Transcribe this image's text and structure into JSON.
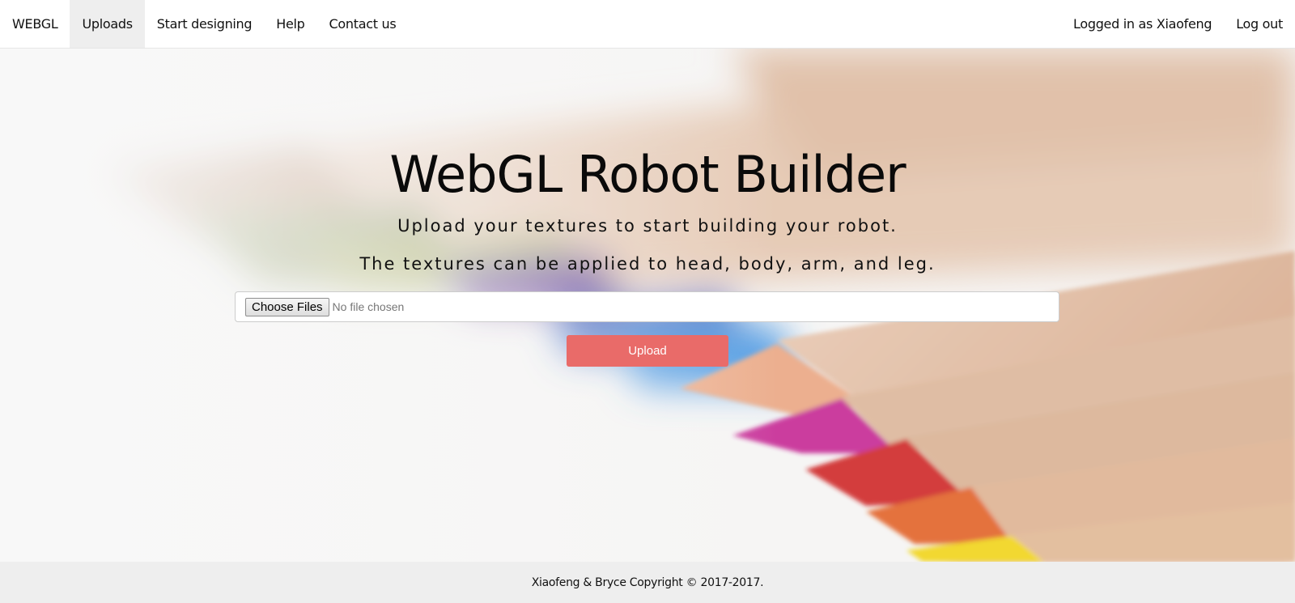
{
  "navbar": {
    "brand": "WEBGL",
    "items": [
      {
        "label": "Uploads",
        "active": true
      },
      {
        "label": "Start designing",
        "active": false
      },
      {
        "label": "Help",
        "active": false
      },
      {
        "label": "Contact us",
        "active": false
      }
    ],
    "user_label": "Logged in as Xiaofeng",
    "logout_label": "Log out"
  },
  "hero": {
    "title": "WebGL Robot Builder",
    "subtitle_1": "Upload your textures to start building your robot.",
    "subtitle_2": "The textures can be applied to head, body, arm, and leg.",
    "file_button_label": "Choose Files",
    "file_status": "No file chosen",
    "upload_label": "Upload",
    "background_image": "colored-pencils-photo"
  },
  "footer": {
    "text": "Xiaofeng & Bryce Copyright © 2017-2017."
  },
  "colors": {
    "upload_button": "#e96b69",
    "active_nav_bg": "#eeeeee",
    "footer_bg": "#eeeeee"
  }
}
